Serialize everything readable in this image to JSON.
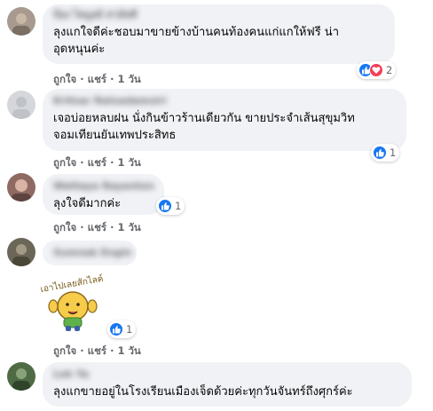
{
  "comments": [
    {
      "author": "ป้อง ไพบูลย์ สามัคคี",
      "lines": [
        "ลุงแกใจดีค่ะชอบมาขายข้างบ้านคนท้องคนแก่แกให้ฟรี น่า",
        "อุดหนุนค่ะ"
      ],
      "actions": {
        "like": "ถูกใจ",
        "reply": "แชร์",
        "time": "1 วัน"
      },
      "reactions": {
        "icons": [
          "like-icon",
          "love-icon"
        ],
        "count": "2"
      },
      "avatar_color": "#a89a8e"
    },
    {
      "author": "Kritsar Ratsadamsiri",
      "lines": [
        "เจอบ่อยหลบฝน นั่งกินข้าวร้านเดียวกัน ขายประจำเส้นสุขุมวิท",
        "จอมเทียนยันเทพประสิทธ"
      ],
      "actions": {
        "like": "ถูกใจ",
        "reply": "แชร์",
        "time": "1 วัน"
      },
      "reactions": {
        "icons": [
          "like-icon"
        ],
        "count": "1"
      },
      "avatar_color": "#d5d7db"
    },
    {
      "author": "Wattaya Rayanton",
      "lines": [
        "ลุงใจดีมากค่ะ"
      ],
      "actions": {
        "like": "ถูกใจ",
        "reply": "แชร์",
        "time": "1 วัน"
      },
      "reactions": {
        "icons": [
          "like-icon"
        ],
        "count": "1"
      },
      "avatar_color": "#8e6a62"
    },
    {
      "author": "Sumnak Engin",
      "sticker": {
        "caption": "เอาไปเลยสักไลค์"
      },
      "actions": {
        "like": "ถูกใจ",
        "reply": "แชร์",
        "time": "1 วัน"
      },
      "reactions": {
        "icons": [
          "like-icon"
        ],
        "count": "1"
      },
      "avatar_color": "#6b6658"
    },
    {
      "author": "Lek Ya",
      "lines": [
        "ลุงแกขายอยู่ในโรงเรียนเมืองเจ็ดด้วยค่ะทุกวันจันทร์ถึงศุกร์ค่ะ"
      ],
      "avatar_color": "#4f6b46"
    }
  ],
  "separator": "·",
  "colors": {
    "like": "#1877f2",
    "love": "#f33e58",
    "bubble": "#f0f2f5",
    "meta": "#65676b"
  }
}
